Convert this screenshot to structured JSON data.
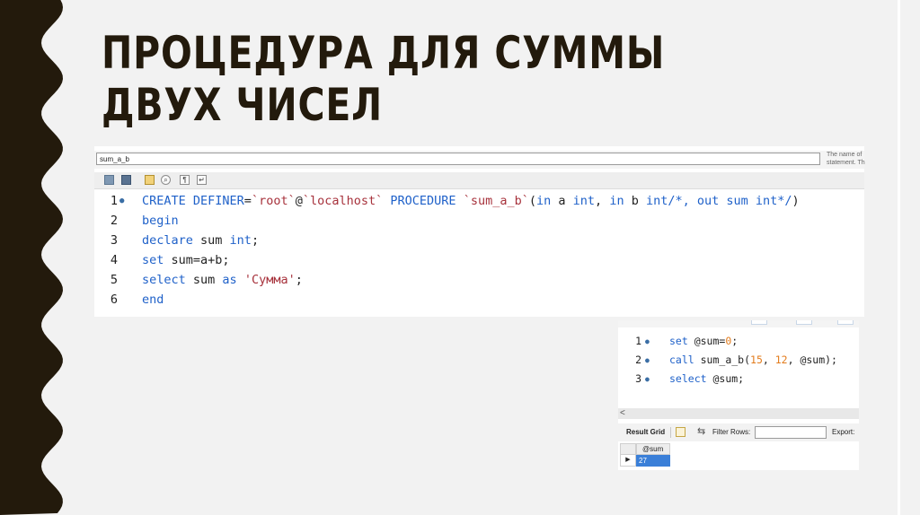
{
  "colors": {
    "background": "#f2f2f2",
    "left_band": "#231a0c",
    "right_bar": "#f4ac20",
    "title": "#231a0c",
    "keyword": "#1f61c9",
    "string": "#a7323c",
    "number": "#e37c1d",
    "selected_cell": "#3a7fd8"
  },
  "title": "ПРОЦЕДУРА ДЛЯ СУММЫ ДВУХ ЧИСЕЛ",
  "editor": {
    "name_value": "sum_a_b",
    "help_text": [
      "The name of",
      "statement. Th"
    ],
    "toolbar_icons": [
      "folder-icon",
      "save-icon",
      "brush-icon",
      "search-icon",
      "paragraph-icon",
      "wrap-icon"
    ],
    "toolbar_glyphs": {
      "search": "⌕",
      "paragraph": "¶",
      "wrap": "↵"
    },
    "lines": [
      {
        "num": "1",
        "parts": [
          [
            "kw",
            "CREATE DEFINER"
          ],
          [
            "p",
            "="
          ],
          [
            "str",
            "`root`"
          ],
          [
            "p",
            "@"
          ],
          [
            "str",
            "`localhost`"
          ],
          [
            "p",
            " "
          ],
          [
            "kw",
            "PROCEDURE"
          ],
          [
            "p",
            " "
          ],
          [
            "str",
            "`sum_a_b`"
          ],
          [
            "p",
            "("
          ],
          [
            "kw",
            "in"
          ],
          [
            "p",
            " a "
          ],
          [
            "kw",
            "int"
          ],
          [
            "p",
            ", "
          ],
          [
            "kw",
            "in"
          ],
          [
            "p",
            " b "
          ],
          [
            "kw",
            "int"
          ],
          [
            "kw",
            "/*, out sum int*/"
          ],
          [
            "p",
            ")"
          ]
        ]
      },
      {
        "num": "2",
        "parts": [
          [
            "kw",
            "begin"
          ]
        ]
      },
      {
        "num": "3",
        "parts": [
          [
            "kw",
            "declare"
          ],
          [
            "p",
            " sum "
          ],
          [
            "kw",
            "int"
          ],
          [
            "p",
            ";"
          ]
        ]
      },
      {
        "num": "4",
        "parts": [
          [
            "kw",
            "set"
          ],
          [
            "p",
            " sum=a+b;"
          ]
        ]
      },
      {
        "num": "5",
        "parts": [
          [
            "kw",
            "select"
          ],
          [
            "p",
            " sum "
          ],
          [
            "kw",
            "as"
          ],
          [
            "p",
            " "
          ],
          [
            "str",
            "'Сумма'"
          ],
          [
            "p",
            ";"
          ]
        ]
      },
      {
        "num": "6",
        "parts": [
          [
            "kw",
            "end"
          ]
        ]
      }
    ]
  },
  "call_editor": {
    "lines": [
      {
        "num": "1",
        "parts": [
          [
            "kw",
            "set"
          ],
          [
            "p",
            " @sum="
          ],
          [
            "num",
            "0"
          ],
          [
            "p",
            ";"
          ]
        ]
      },
      {
        "num": "2",
        "parts": [
          [
            "kw",
            "call"
          ],
          [
            "p",
            " sum_a_b("
          ],
          [
            "num",
            "15"
          ],
          [
            "p",
            ", "
          ],
          [
            "num",
            "12"
          ],
          [
            "p",
            ", @sum);"
          ]
        ]
      },
      {
        "num": "3",
        "parts": [
          [
            "kw",
            "select"
          ],
          [
            "p",
            " @sum;"
          ]
        ]
      }
    ],
    "scroll_left": "<"
  },
  "result": {
    "tab_label": "Result Grid",
    "filter_label": "Filter Rows:",
    "filter_value": "",
    "export_label": "Export:",
    "filter_glyph": "⇆",
    "column": "@sum",
    "row_indicator": "▶",
    "value": "27"
  }
}
